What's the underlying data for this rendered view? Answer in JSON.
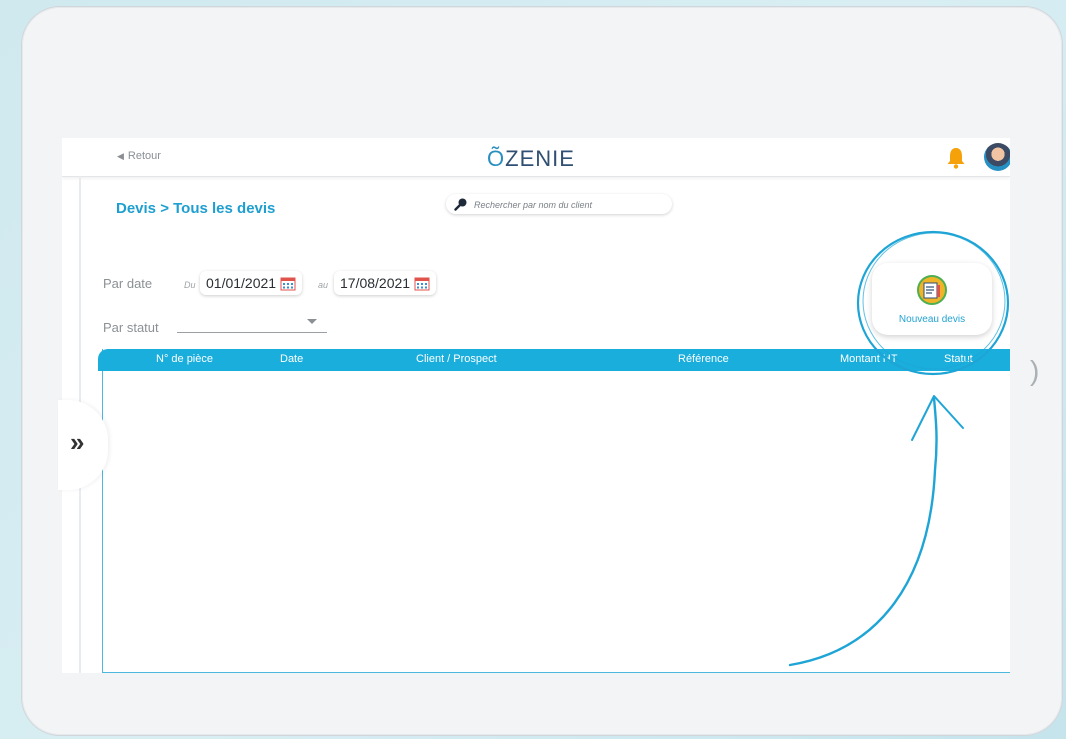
{
  "header": {
    "back_label": "Retour",
    "logo_tilde": "Õ",
    "logo_text": "ZENIE",
    "notification_icon": "bell-icon",
    "avatar_icon": "user-avatar"
  },
  "page": {
    "breadcrumb": "Devis > Tous les devis"
  },
  "search": {
    "placeholder": "Rechercher par nom du client"
  },
  "filters": {
    "date_label": "Par date",
    "from_label": "Du",
    "from_value": "01/01/2021",
    "to_label": "au",
    "to_value": "17/08/2021",
    "status_label": "Par statut",
    "status_value": ""
  },
  "actions": {
    "new_quote_label": "Nouveau devis"
  },
  "table": {
    "columns": [
      "N° de pièce",
      "Date",
      "Client / Prospect",
      "Référence",
      "Montant HT",
      "Statut"
    ],
    "rows": []
  },
  "sidebar": {
    "expand_icon": "double-chevron-right-icon"
  },
  "colors": {
    "accent": "#19aedc",
    "brand_dark": "#2f4f73",
    "annotation": "#1ea5d6"
  }
}
